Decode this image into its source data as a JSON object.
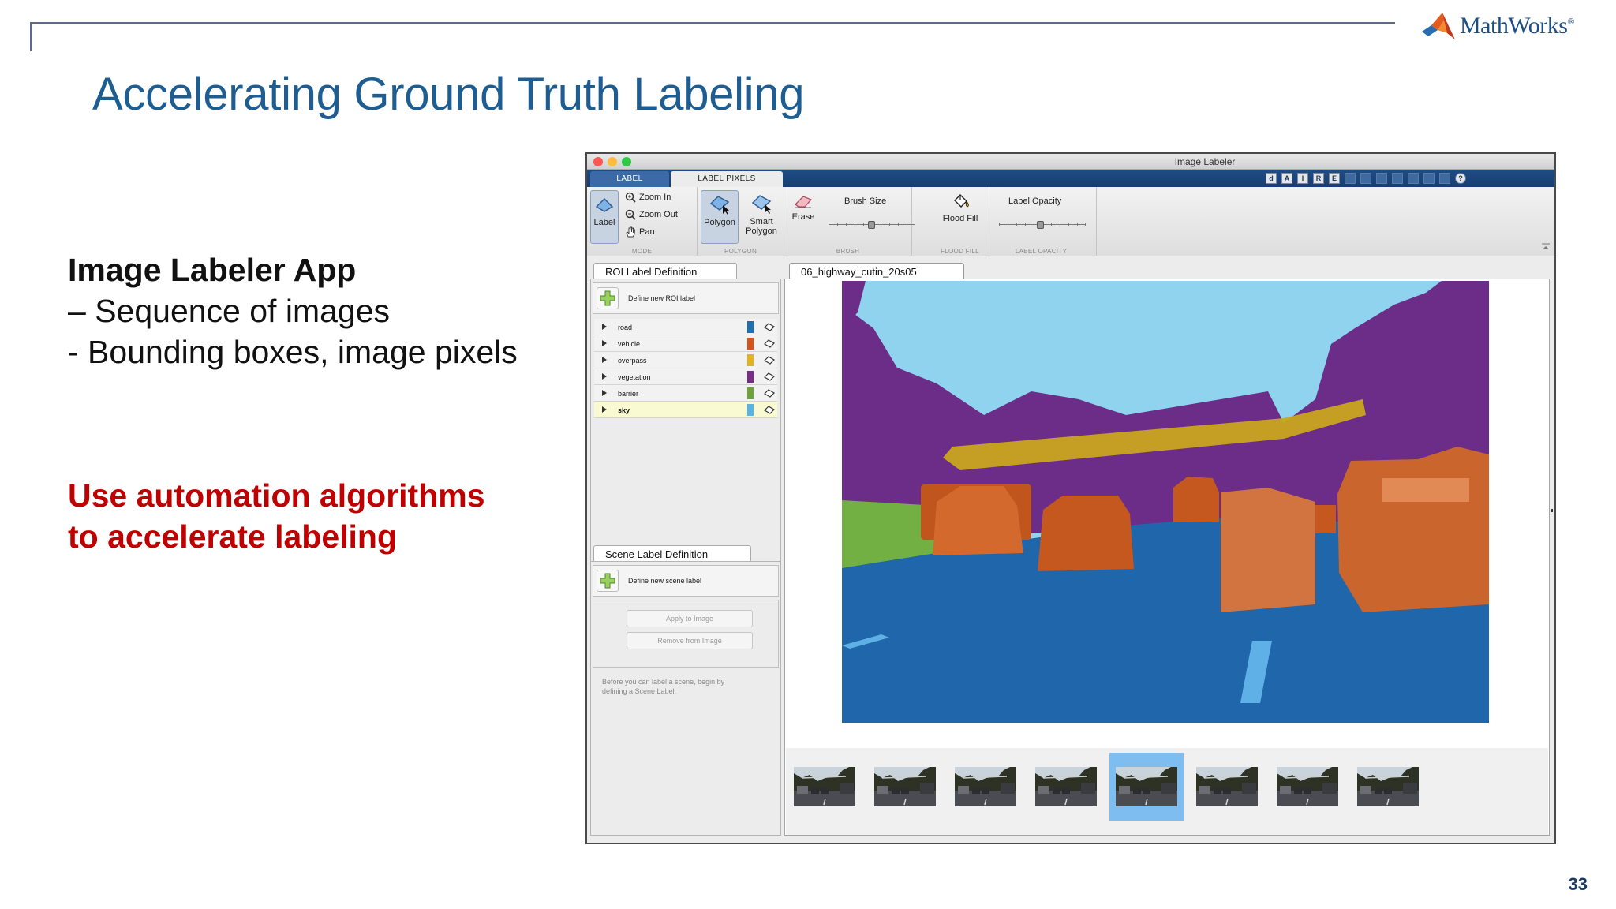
{
  "slide": {
    "title": "Accelerating Ground Truth Labeling",
    "logo_text": "MathWorks",
    "logo_reg": "®",
    "bullets": {
      "heading": "Image Labeler App",
      "line1": "– Sequence of images",
      "line2": "-  Bounding boxes, image pixels"
    },
    "highlight": {
      "line1": "Use automation algorithms",
      "line2": "to accelerate labeling"
    },
    "page_number": "33"
  },
  "app": {
    "window_title": "Image Labeler",
    "traffic_lights": [
      "#fc5753",
      "#fdbc40",
      "#33c748"
    ],
    "tabs": {
      "label": "LABEL",
      "label_pixels": "LABEL PIXELS"
    },
    "quick_access": [
      "d",
      "A",
      "I",
      "R",
      "E"
    ],
    "toolstrip": {
      "mode": {
        "group_label": "MODE",
        "label_button": "Label",
        "zoom_in": "Zoom In",
        "zoom_out": "Zoom Out",
        "pan": "Pan"
      },
      "polygon": {
        "group_label": "POLYGON",
        "polygon": "Polygon",
        "smart_polygon_1": "Smart",
        "smart_polygon_2": "Polygon"
      },
      "brush": {
        "group_label": "BRUSH",
        "erase": "Erase",
        "brush_size": "Brush Size"
      },
      "flood_fill": {
        "group_label": "FLOOD FILL",
        "flood_fill": "Flood Fill"
      },
      "label_opacity": {
        "group_label": "LABEL OPACITY",
        "label_opacity": "Label Opacity"
      }
    },
    "roi_panel": {
      "tab_title": "ROI Label Definition",
      "define_label": "Define new ROI label",
      "labels": [
        {
          "name": "road",
          "color": "#1f6fb4",
          "selected": false
        },
        {
          "name": "vehicle",
          "color": "#d4541a",
          "selected": false
        },
        {
          "name": "overpass",
          "color": "#e3b21f",
          "selected": false
        },
        {
          "name": "vegetation",
          "color": "#7a2c8a",
          "selected": false
        },
        {
          "name": "barrier",
          "color": "#6ea23a",
          "selected": false
        },
        {
          "name": "sky",
          "color": "#57b4e3",
          "selected": true
        }
      ]
    },
    "scene_panel": {
      "tab_title": "Scene Label Definition",
      "define_label": "Define new scene label",
      "apply_button": "Apply to Image",
      "remove_button": "Remove from Image",
      "hint_line1": "Before you can label a scene, begin by",
      "hint_line2": "defining a Scene Label."
    },
    "display": {
      "tab_title": "06_highway_cutin_20s05",
      "selected_frame": 5,
      "frame_count": 8
    }
  }
}
